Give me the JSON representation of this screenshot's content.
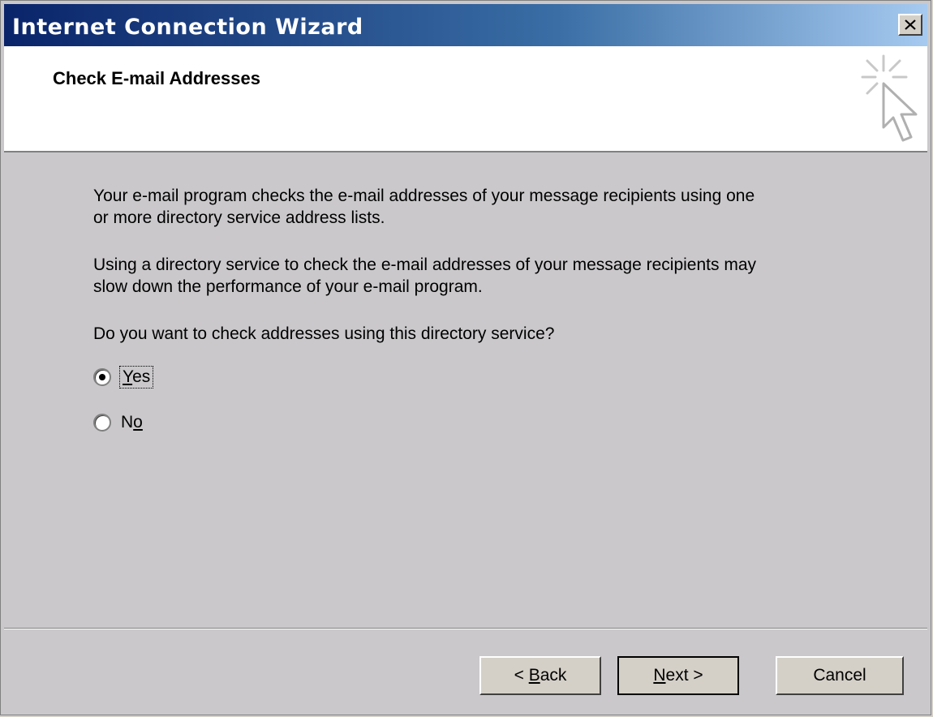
{
  "window": {
    "title": "Internet Connection Wizard",
    "close_glyph": "✕"
  },
  "header": {
    "title": "Check E-mail Addresses",
    "icon": "wizard-cursor-icon"
  },
  "content": {
    "para1_line1": "Your e-mail program checks the e-mail addresses of your message recipients using one",
    "para1_line2": "or more directory service address lists.",
    "para2_line1": "Using a directory service to check the e-mail addresses of your message recipients may",
    "para2_line2": "slow down the performance of your e-mail program.",
    "question": "Do you want to check addresses using this directory service?",
    "options": [
      {
        "label_pre": "",
        "label_key": "Y",
        "label_post": "es",
        "selected": true
      },
      {
        "label_pre": "N",
        "label_key": "o",
        "label_post": "",
        "selected": false
      }
    ]
  },
  "buttons": {
    "back_pre": "< ",
    "back_key": "B",
    "back_post": "ack",
    "next_pre": "",
    "next_key": "N",
    "next_post": "ext >",
    "cancel": "Cancel"
  },
  "colors": {
    "title_gradient_start": "#0a246a",
    "title_gradient_end": "#a6caf0",
    "body_bg": "#cac8cb"
  }
}
